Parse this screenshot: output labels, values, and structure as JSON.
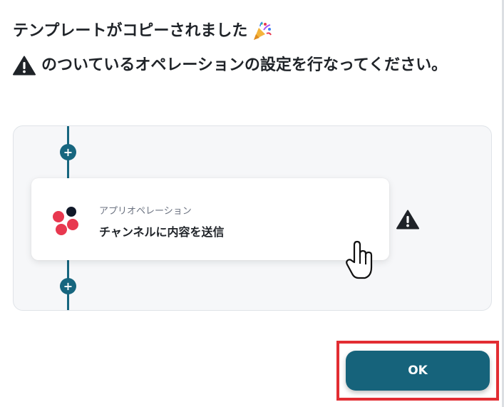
{
  "dialog": {
    "line1": "テンプレートがコピーされました",
    "line2": "のついているオペレーションの設定を行なってください。"
  },
  "flow": {
    "add_button_label": "+",
    "operation": {
      "category": "アプリオペレーション",
      "title": "チャンネルに内容を送信"
    }
  },
  "ok_button": {
    "label": "OK"
  },
  "icons": {
    "celebration": "party-popper-icon",
    "warning": "warning-triangle-icon",
    "app": "chatwork-logo-icon",
    "cursor": "hand-pointer-icon"
  },
  "colors": {
    "primary": "#16637b",
    "connector": "#17667f",
    "highlight": "#e22d33",
    "logo_red": "#e8384f",
    "logo_dark": "#101828"
  }
}
